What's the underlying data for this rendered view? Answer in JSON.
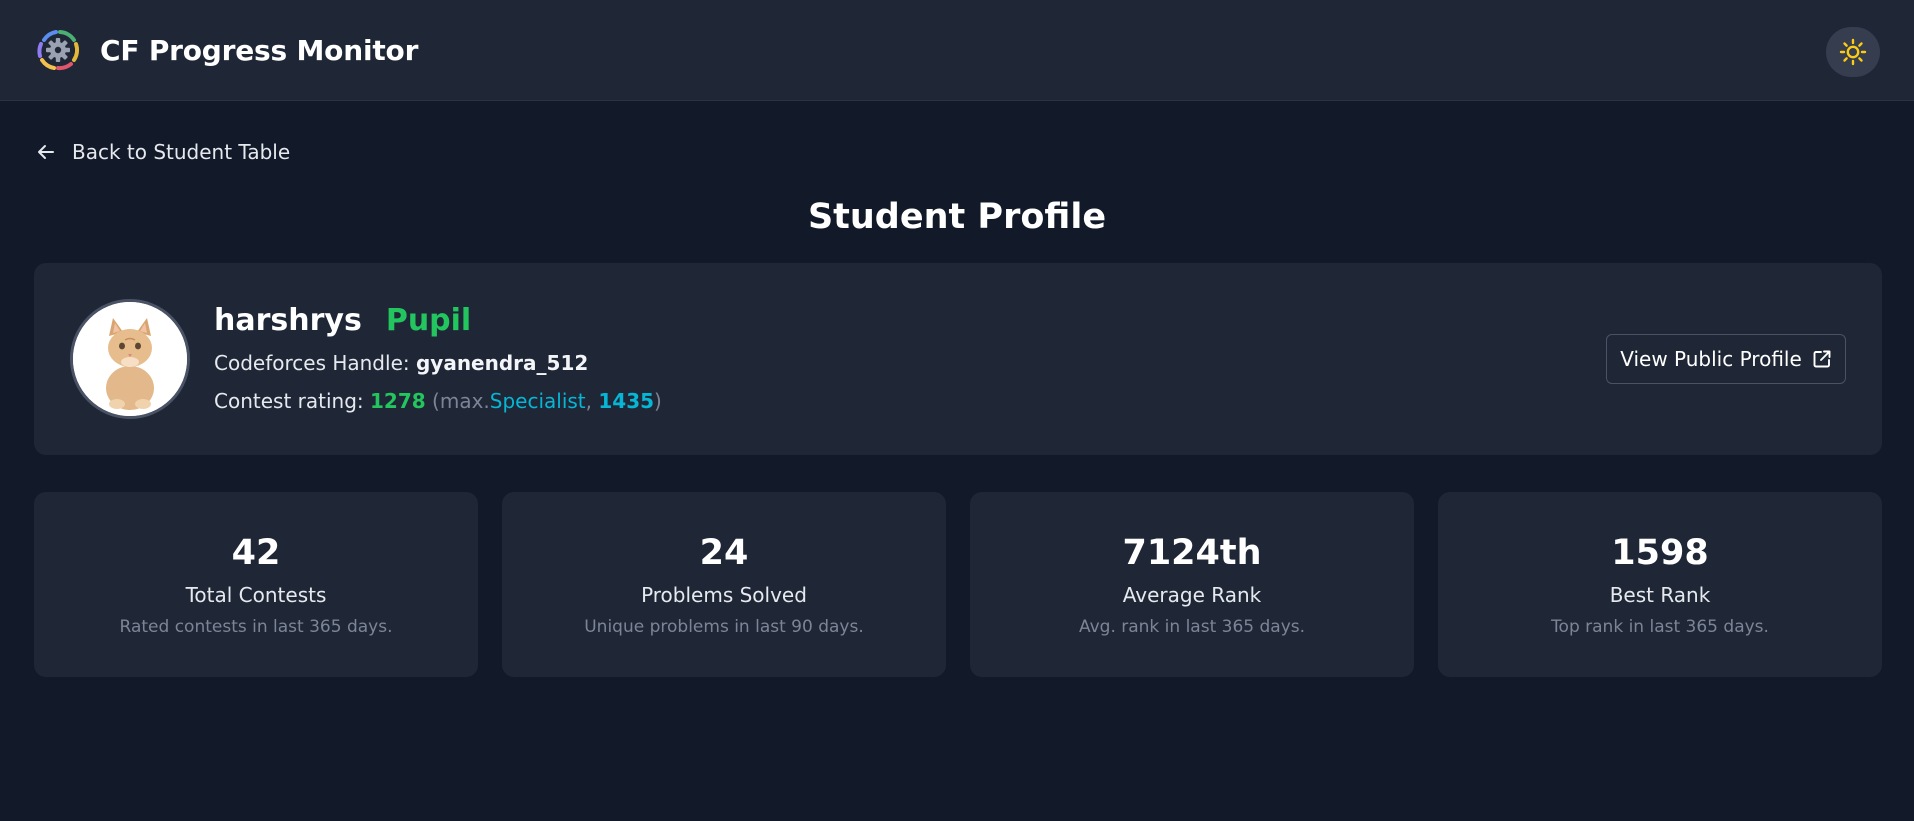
{
  "header": {
    "title": "CF Progress Monitor",
    "logo_icon": "gear-ring-logo",
    "theme_toggle_icon": "sun-icon",
    "colors": {
      "background": "#1f2737",
      "sun": "#facc15"
    }
  },
  "nav": {
    "back_label": "Back to Student Table",
    "back_icon": "arrow-left-icon"
  },
  "page": {
    "title": "Student Profile"
  },
  "profile": {
    "name": "harshrys",
    "rank": "Pupil",
    "handle_label": "Codeforces Handle:",
    "handle": "gyanendra_512",
    "rating_label": "Contest rating:",
    "rating": "1278",
    "max_open": "(max.",
    "max_rank": "Specialist",
    "max_sep": ",",
    "max_rating": "1435",
    "max_close": ")",
    "view_button_label": "View Public Profile",
    "view_button_icon": "external-link-icon",
    "colors": {
      "pupil": "#22c55e",
      "specialist": "#06b6d4"
    }
  },
  "stats": [
    {
      "value": "42",
      "label": "Total Contests",
      "description": "Rated contests in last 365 days."
    },
    {
      "value": "24",
      "label": "Problems Solved",
      "description": "Unique problems in last 90 days."
    },
    {
      "value": "7124th",
      "label": "Average Rank",
      "description": "Avg. rank in last 365 days."
    },
    {
      "value": "1598",
      "label": "Best Rank",
      "description": "Top rank in last 365 days."
    }
  ]
}
